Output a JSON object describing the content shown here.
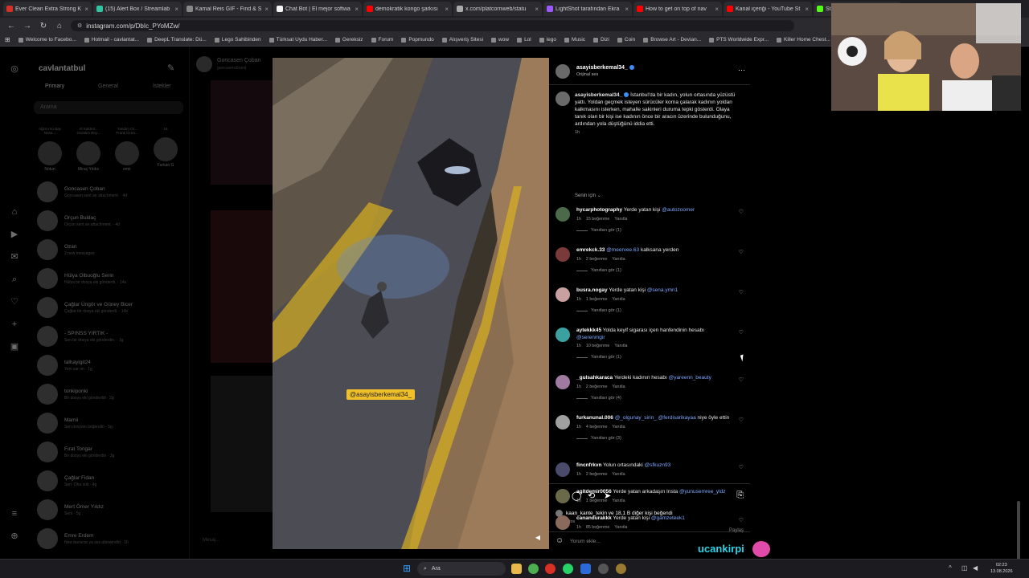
{
  "browser": {
    "tabs": [
      {
        "label": "Ever Clean Extra Strong K",
        "color": "#d93025"
      },
      {
        "label": "(15) Alert Box / Streamlab",
        "color": "#31c3a2"
      },
      {
        "label": "Kamal Reis GIF - Find & S",
        "color": "#888888"
      },
      {
        "label": "Chat Bot | El mejor softwa",
        "color": "#f5f5f5"
      },
      {
        "label": "demokratik kongo şarkısı",
        "color": "#ff0000"
      },
      {
        "label": "x.com/platcornweb/statu",
        "color": "#aaaaaa"
      },
      {
        "label": "LightShot tarafından Ekra",
        "color": "#9b59ff"
      },
      {
        "label": "How to get on top of nav",
        "color": "#ff0000"
      },
      {
        "label": "Kanal içeriği - YouTube St",
        "color": "#ff0000"
      },
      {
        "label": "Stream - Kick Dashbo",
        "color": "#53fc18"
      }
    ],
    "url": "instagram.com/p/DbIc_PYoMZw/",
    "bookmarks": [
      "Welcome to Facebo...",
      "Hotmail - cavlantat...",
      "DeepL Translate: Dü...",
      "Lego Sahibinden",
      "Türksat Uydu Haber...",
      "Gereksiz",
      "Forum",
      "Popmundo",
      "Alışveriş Sitesi",
      "wow",
      "Lol",
      "lego",
      "Music",
      "Dizi",
      "Coin",
      "Browse Art - Devian...",
      "PTS Worldwide Expr...",
      "Killer Home Chest..."
    ]
  },
  "inbox": {
    "username": "cavlantatbul",
    "tabs": [
      "Primary",
      "General",
      "İstekler"
    ],
    "search_placeholder": "Arama",
    "stories": [
      {
        "note": "Ağzını ko Bay Nasa...",
        "name": "Notun"
      },
      {
        "note": "Af Kaldırıl... Güzelim Bey...",
        "name": "Miraç Yıldız"
      },
      {
        "note": "Yandım Ol... Frank Ocea...",
        "name": "emir"
      },
      {
        "note": "16",
        "name": "Furkan G"
      }
    ],
    "conversations": [
      {
        "name": "Goncasen Çoban",
        "sub": "Goncasen sent an attachment. · 4d"
      },
      {
        "name": "Orçun Buldaç",
        "sub": "Orçun sent an attachment. · 4d"
      },
      {
        "name": "Ozan",
        "sub": "2 new messages"
      },
      {
        "name": "Hülya Olbuoğlu Serin",
        "sub": "Hülya bir dosya eki gönderdi. · 14s"
      },
      {
        "name": "Çağlar Üngör ve Güney Bicer",
        "sub": "Çağlar bir dosya eki gönderdi. · 14s"
      },
      {
        "name": "- SPINSS YIRTIK -",
        "sub": "Sen bir dosya eki gönderdin. · 1g"
      },
      {
        "name": "talhayigit24",
        "sub": "Yeni sar ım · 1g"
      },
      {
        "name": "tonkiponki",
        "sub": "Bir dosya eki gönderildi · 2g"
      },
      {
        "name": "Mamii",
        "sub": "Sen dosyanı beğendin · 5g"
      },
      {
        "name": "Fırat Tongar",
        "sub": "Bir dosya eki gönderdin · 3g"
      },
      {
        "name": "Çağlar Fidan",
        "sub": "Sen: Oha süit · 4g"
      },
      {
        "name": "Mert Ömer Yıldız",
        "sub": "Sent · 5g"
      },
      {
        "name": "Emre Erdem",
        "sub": "New banxcar ya ass abiswindid · 1h"
      }
    ]
  },
  "feed": {
    "profile": "Goncasen Çoban",
    "handle": "goncasenciband",
    "message_placeholder": "Mesaj..."
  },
  "post": {
    "author": "asayisberkemal34_",
    "audio": "Orijinal ses",
    "video_tag": "@asayisberkemal34_",
    "caption_user": "asayisberkemal34_",
    "caption_text": "İstanbul'da bir kadın, yolun ortasında yüzüstü yattı. Yoldan geçmek isteyen sürücüler korna çalarak kadının yoldan kalkmasını isterken, mahalle sakinleri duruma tepki gösterdi. Olaya tanık olan bir kişi ise kadının önce bir aracın üzerinde bulunduğunu, ardından yola düştüğünü iddia etti.",
    "caption_time": "1h",
    "sort_label": "Senin için",
    "comments": [
      {
        "user": "hycarphotography",
        "text": "Yerde yatan kişi",
        "mention": "@autozoomer",
        "time": "1h",
        "likes": "15 beğenme",
        "reply": "Yanıtla",
        "replies": "Yanıtları gör (1)"
      },
      {
        "user": "emrekck.33",
        "text": "",
        "mention": "@meervee.63",
        "text2": "kalksana yerden",
        "time": "1h",
        "likes": "2 beğenme",
        "reply": "Yanıtla",
        "replies": "Yanıtları gör (1)"
      },
      {
        "user": "busra.nogay",
        "text": "Yerde yatan kişi",
        "mention": "@sena.ymn1",
        "time": "1h",
        "likes": "1 beğenme",
        "reply": "Yanıtla",
        "replies": "Yanıtları gör (1)"
      },
      {
        "user": "aytekkk45",
        "text": "Yolda keyif sigarası içen hanfendinin hesabı",
        "mention": "@serenmgir",
        "time": "1h",
        "likes": "10 beğenme",
        "reply": "Yanıtla",
        "replies": "Yanıtları gör (1)"
      },
      {
        "user": "_gulsahkaraca",
        "text": "Yerdeki kadının hesabı",
        "mention": "@yareenn_beauty",
        "time": "1h",
        "likes": "2 beğenme",
        "reply": "Yanıtla",
        "replies": "Yanıtları gör (4)"
      },
      {
        "user": "furkanunal.006",
        "text": "",
        "mention": "@_olgunay_sirin_ @ferdisarikayaa",
        "text2": "niye öyle ettin",
        "time": "1h",
        "likes": "4 beğenme",
        "reply": "Yanıtla",
        "replies": "Yanıtları gör (3)"
      },
      {
        "user": "fincnfrkvn",
        "text": "Yolun ortasındaki",
        "mention": "@sfkuzn93",
        "time": "1h",
        "likes": "2 beğenme",
        "reply": "Yanıtla",
        "replies": ""
      },
      {
        "user": "agitdemir0056",
        "text": "Yerde yatan arkadaşın Insta",
        "mention": "@yunusemree_yldz",
        "time": "1h",
        "likes": "1 beğenme",
        "reply": "Yanıtla",
        "replies": ""
      },
      {
        "user": "canandurakkk",
        "text": "Yerde yatan kişi",
        "mention": "@gamzeteek1",
        "time": "1h",
        "likes": "85 beğenme",
        "reply": "Yanıtla",
        "replies": ""
      }
    ],
    "likes_text": "kaan_kante_tekin ve 18,1 B diğer kişi beğendi",
    "date": "3 Ağustos",
    "comment_placeholder": "Yorum ekle...",
    "post_label": "Paylaş"
  },
  "overlay": {
    "streamer_name": "ucankirpi"
  },
  "taskbar": {
    "search_label": "Ara",
    "time": "02:23",
    "date": "13.08.2026"
  },
  "colors": {
    "accent_blue": "#3d8ff5",
    "mention": "#7fa8ff",
    "tag_pill": "#f0c02a",
    "streamer_text": "#27d3e8"
  }
}
